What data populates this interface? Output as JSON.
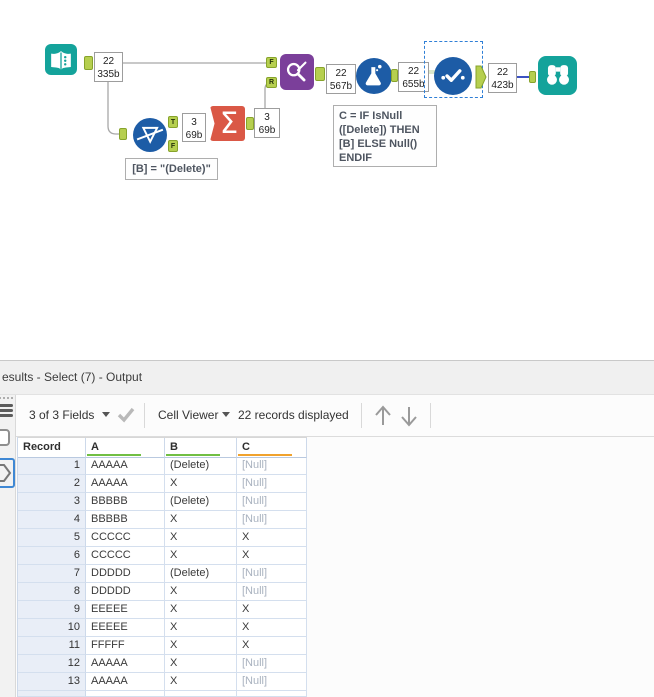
{
  "canvas": {
    "tools": {
      "input": {
        "icon": "book-icon",
        "color": "#14a39b"
      },
      "filter": {
        "icon": "funnel-icon",
        "color": "#1d5ca6"
      },
      "summarize": {
        "icon": "sigma-icon",
        "color": "#da5846"
      },
      "find_replace": {
        "icon": "magnifier-pencil-icon",
        "color": "#7b3f9a"
      },
      "formula": {
        "icon": "flask-icon",
        "color": "#1d5ca6"
      },
      "select": {
        "icon": "checkmark-icon",
        "color": "#1d5ca6"
      },
      "browse": {
        "icon": "binoculars-icon",
        "color": "#14a39b"
      }
    },
    "connection_labels": {
      "input_out": {
        "count": "22",
        "size": "335b"
      },
      "filter_true": {
        "count": "3",
        "size": "69b"
      },
      "summarize_out": {
        "count": "3",
        "size": "69b"
      },
      "findreplace_out": {
        "count": "22",
        "size": "567b"
      },
      "formula_out": {
        "count": "22",
        "size": "655b"
      },
      "select_out": {
        "count": "22",
        "size": "423b"
      }
    },
    "anchor_letters": {
      "filter_true": "T",
      "filter_false": "F",
      "findreplace_f": "F",
      "findreplace_r": "R"
    },
    "comments": {
      "filter_expression": "[B] = \"(Delete)\"",
      "formula_expression_lines": [
        "C = IF IsNull",
        "([Delete]) THEN",
        "[B] ELSE Null()",
        "ENDIF"
      ]
    },
    "selected_connection_color": "#3c52c2"
  },
  "results": {
    "title": "esults - Select (7) - Output",
    "toolbar": {
      "fields_dropdown": "3 of 3 Fields",
      "cell_viewer_dropdown": "Cell Viewer",
      "records_displayed": "22 records displayed"
    },
    "table": {
      "headers": [
        "Record",
        "A",
        "B",
        "C"
      ],
      "header_underlines": [
        "",
        "#71bf44",
        "#71bf44",
        "#f0a22e"
      ],
      "null_display": "[Null]",
      "rows": [
        {
          "record": "1",
          "A": "AAAAA",
          "B": "(Delete)",
          "C": "[Null]"
        },
        {
          "record": "2",
          "A": "AAAAA",
          "B": "X",
          "C": "[Null]"
        },
        {
          "record": "3",
          "A": "BBBBB",
          "B": "(Delete)",
          "C": "[Null]"
        },
        {
          "record": "4",
          "A": "BBBBB",
          "B": "X",
          "C": "[Null]"
        },
        {
          "record": "5",
          "A": "CCCCC",
          "B": "X",
          "C": "X"
        },
        {
          "record": "6",
          "A": "CCCCC",
          "B": "X",
          "C": "X"
        },
        {
          "record": "7",
          "A": "DDDDD",
          "B": "(Delete)",
          "C": "[Null]"
        },
        {
          "record": "8",
          "A": "DDDDD",
          "B": "X",
          "C": "[Null]"
        },
        {
          "record": "9",
          "A": "EEEEE",
          "B": "X",
          "C": "X"
        },
        {
          "record": "10",
          "A": "EEEEE",
          "B": "X",
          "C": "X"
        },
        {
          "record": "11",
          "A": "FFFFF",
          "B": "X",
          "C": "X"
        },
        {
          "record": "12",
          "A": "AAAAA",
          "B": "X",
          "C": "[Null]"
        },
        {
          "record": "13",
          "A": "AAAAA",
          "B": "X",
          "C": "[Null]"
        },
        {
          "record": "",
          "A": "",
          "B": "",
          "C": ""
        }
      ]
    }
  }
}
